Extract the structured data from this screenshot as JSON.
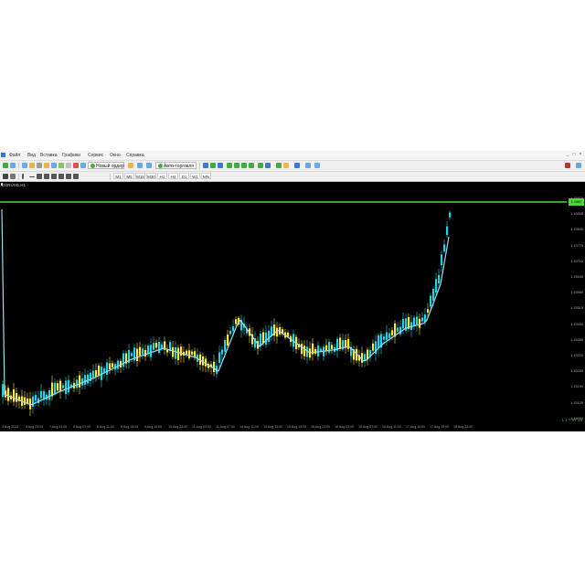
{
  "window": {
    "menu": [
      "Файл",
      "Вид",
      "Вставка",
      "Графики",
      "Сервис",
      "Окно",
      "Справка"
    ],
    "controls": [
      "_",
      "□",
      "×"
    ]
  },
  "toolbar": {
    "new_order_label": "Новый ордер",
    "auto_trading_label": "Авто-торговля",
    "timeframes": [
      "M1",
      "M5",
      "M15",
      "M30",
      "H1",
      "H4",
      "D1",
      "W1",
      "MN"
    ]
  },
  "chart": {
    "symbol_label": "EURUSD,H1",
    "current_price": "1.1592",
    "price_scale": [
      "1.15970",
      "1.15905",
      "1.15840",
      "1.15775",
      "1.15710",
      "1.15645",
      "1.15580",
      "1.15515",
      "1.15450",
      "1.15385",
      "1.15320",
      "1.15255",
      "1.15190",
      "1.15125",
      "1.15060"
    ],
    "time_axis": [
      "4 Aug 2023",
      "4 Aug 23:00",
      "7 Aug 03:00",
      "8 Aug 07:00",
      "8 Aug 11:00",
      "9 Aug 15:00",
      "9 Aug 19:00",
      "10 Aug 23:00",
      "11 Aug 03:00",
      "11 Aug 07:00",
      "14 Aug 11:00",
      "14 Aug 15:00",
      "15 Aug 19:00",
      "15 Aug 23:00",
      "16 Aug 03:00",
      "16 Aug 07:00",
      "16 Aug 11:00",
      "17 Aug 15:00",
      "17 Aug 19:00",
      "18 Aug 23:00"
    ],
    "status_text": "1   1   7   07:15",
    "colors": {
      "background": "#000000",
      "bull": "#22d3e6",
      "bear": "#ffe83a",
      "ma": "#9fdcf0",
      "price_line": "#4cd63c"
    }
  }
}
